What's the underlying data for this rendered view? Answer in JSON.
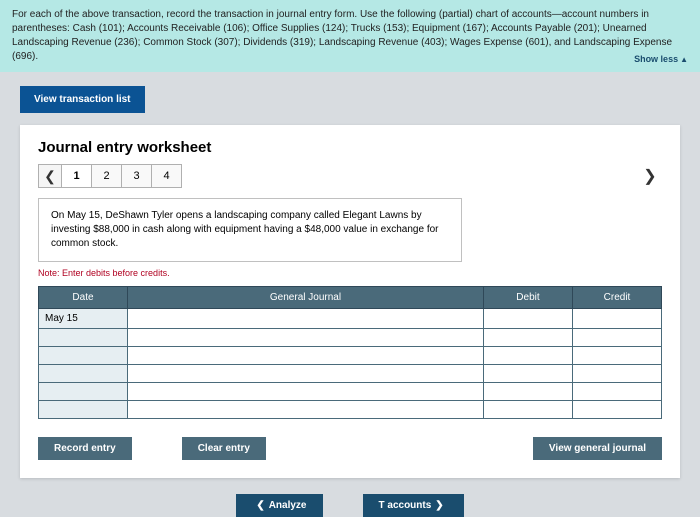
{
  "instructions": "For each of the above transaction, record the transaction in journal entry form. Use the following (partial) chart of accounts—account numbers in parentheses: Cash (101); Accounts Receivable (106); Office Supplies (124); Trucks (153); Equipment (167); Accounts Payable (201); Unearned Landscaping Revenue (236); Common Stock (307); Dividends (319); Landscaping Revenue (403); Wages Expense (601), and Landscaping Expense (696).",
  "show_less": "Show less",
  "view_transaction_list": "View transaction list",
  "worksheet_title": "Journal entry worksheet",
  "nav": {
    "items": [
      "1",
      "2",
      "3",
      "4"
    ],
    "active": "1"
  },
  "description": "On May 15, DeShawn Tyler opens a landscaping company called Elegant Lawns by investing $88,000 in cash along with equipment having a $48,000 value in exchange for common stock.",
  "note": "Note: Enter debits before credits.",
  "table": {
    "headers": {
      "date": "Date",
      "gj": "General Journal",
      "debit": "Debit",
      "credit": "Credit"
    },
    "first_date": "May 15"
  },
  "buttons": {
    "record": "Record entry",
    "clear": "Clear entry",
    "view_gj": "View general journal",
    "analyze": "Analyze",
    "taccounts": "T accounts"
  }
}
